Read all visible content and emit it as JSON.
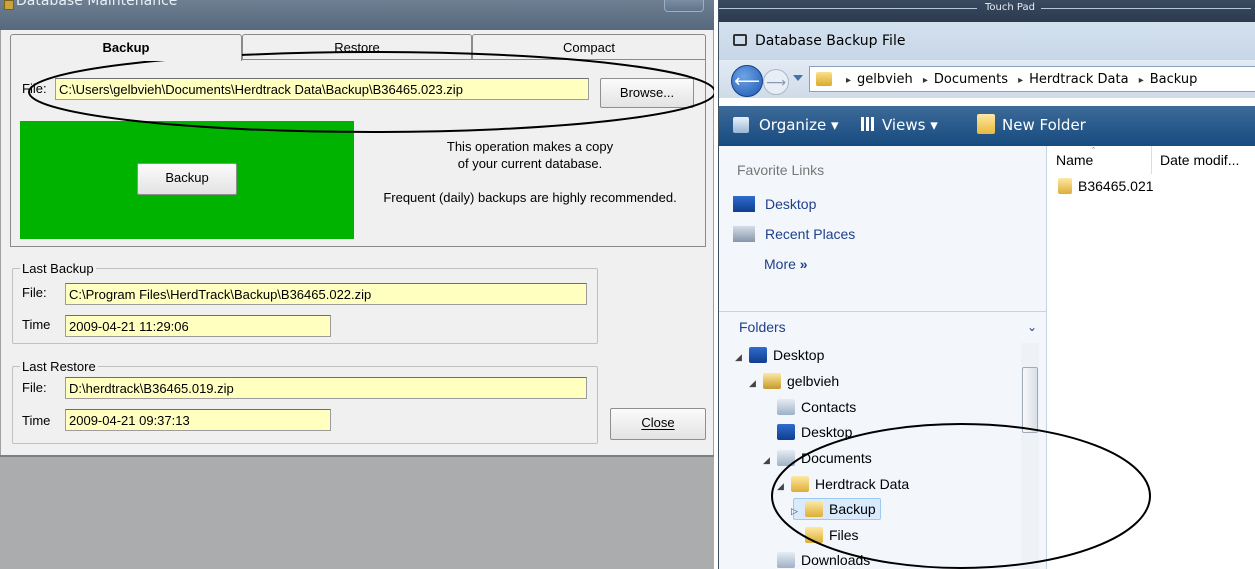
{
  "maintenance": {
    "title": "Database Maintenance",
    "tabs": [
      {
        "label": "Backup",
        "active": true
      },
      {
        "label": "Restore",
        "active": false
      },
      {
        "label": "Compact",
        "active": false
      }
    ],
    "file_label": "File:",
    "file_value": "C:\\Users\\gelbvieh\\Documents\\Herdtrack Data\\Backup\\B36465.023.zip",
    "browse_label": "Browse...",
    "backup_button": "Backup",
    "description_line1": "This operation makes a copy",
    "description_line2": "of your current database.",
    "description_line3": "Frequent (daily) backups are highly recommended.",
    "last_backup": {
      "legend": "Last Backup",
      "file_label": "File:",
      "file_value": "C:\\Program Files\\HerdTrack\\Backup\\B36465.022.zip",
      "time_label": "Time",
      "time_value": "2009-04-21 11:29:06"
    },
    "last_restore": {
      "legend": "Last Restore",
      "file_label": "File:",
      "file_value": "D:\\herdtrack\\B36465.019.zip",
      "time_label": "Time",
      "time_value": "2009-04-21 09:37:13"
    },
    "close_label": "Close",
    "accent_green": "#00b300",
    "field_bg": "#ffffc0"
  },
  "file_dialog": {
    "title": "Database Backup File",
    "overlay_text": "Touch Pad",
    "breadcrumb": [
      "gelbvieh",
      "Documents",
      "Herdtrack Data",
      "Backup"
    ],
    "toolbar": {
      "organize": "Organize",
      "views": "Views",
      "new_folder": "New Folder"
    },
    "favorite_links_header": "Favorite Links",
    "favorites": [
      "Desktop",
      "Recent Places"
    ],
    "more_label": "More",
    "folders_header": "Folders",
    "tree": [
      {
        "label": "Desktop",
        "expanded": true
      },
      {
        "label": "gelbvieh",
        "expanded": true
      },
      {
        "label": "Contacts"
      },
      {
        "label": "Desktop"
      },
      {
        "label": "Documents",
        "expanded": true
      },
      {
        "label": "Herdtrack Data",
        "expanded": true
      },
      {
        "label": "Backup",
        "selected": true
      },
      {
        "label": "Files"
      },
      {
        "label": "Downloads"
      }
    ],
    "columns": [
      "Name",
      "Date modif..."
    ],
    "files": [
      "B36465.021"
    ],
    "command_bar_color": "#174a7f"
  }
}
